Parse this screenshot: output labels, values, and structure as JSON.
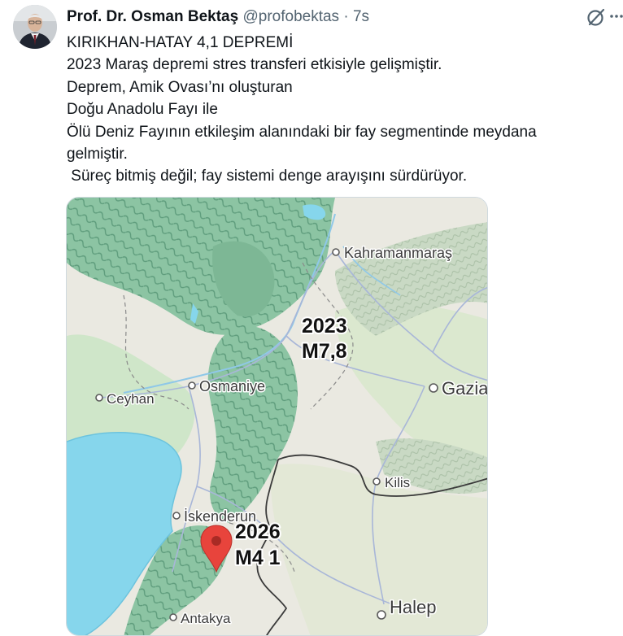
{
  "author": {
    "name": "Prof. Dr. Osman Bektaş",
    "handle": "@profobektas",
    "separator": "·",
    "time": "7s"
  },
  "actions": {
    "grok_icon": "grok-icon",
    "more_icon": "more-icon"
  },
  "tweet": {
    "lines": [
      "KIRIKHAN-HATAY 4,1 DEPREMİ",
      "2023 Maraş depremi stres transferi etkisiyle gelişmiştir.",
      "Deprem, Amik Ovası’nı oluşturan",
      "Doğu Anadolu Fayı ile",
      "Ölü Deniz Fayının etkileşim alanındaki bir fay segmentinde meydana gelmiştir.",
      " Süreç bitmiş değil; fay sistemi denge arayışını sürdürüyor."
    ]
  },
  "map": {
    "cities": {
      "kahramanmaras": "Kahramanmaraş",
      "osmaniye": "Osmaniye",
      "gaziantep": "Gazia",
      "ceyhan": "Ceyhan",
      "kilis": "Kilis",
      "iskenderun": "İskenderun",
      "halep": "Halep",
      "antakya": "Antakya"
    },
    "quake_2023": {
      "year": "2023",
      "magnitude": "M7,8"
    },
    "quake_2026": {
      "year": "2026",
      "magnitude": "M4 1"
    },
    "colors": {
      "sea": "#86d6ec",
      "forest": "#8fc6a6",
      "land": "#eae9e1",
      "marker": "#e8443c",
      "border": "#3a3a3a"
    }
  }
}
